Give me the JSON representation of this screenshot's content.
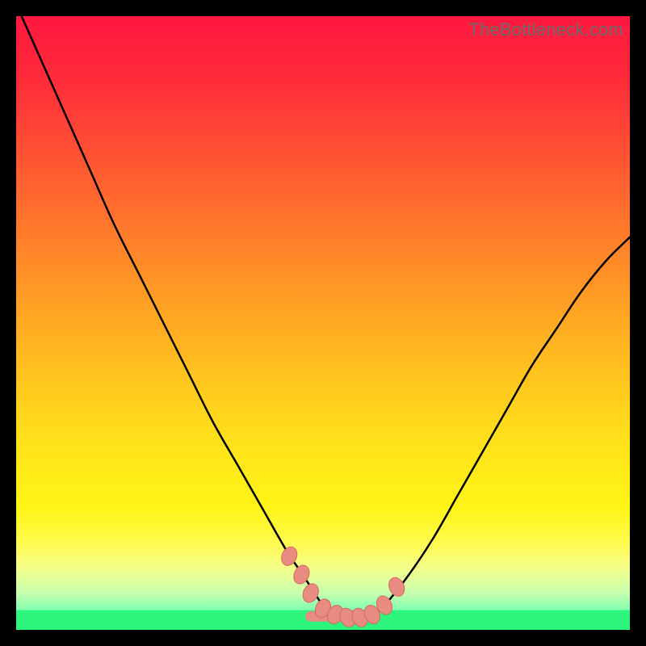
{
  "watermark": {
    "text": "TheBottleneck.com"
  },
  "colors": {
    "black": "#000000",
    "curve": "#000000",
    "marker_fill": "#e88b81",
    "marker_stroke": "#d66a60",
    "green_band": "#2bf57a",
    "gradient_stops": [
      {
        "offset": 0.0,
        "color": "#ff173f"
      },
      {
        "offset": 0.1,
        "color": "#ff2b3a"
      },
      {
        "offset": 0.2,
        "color": "#ff4a34"
      },
      {
        "offset": 0.3,
        "color": "#ff6a2e"
      },
      {
        "offset": 0.4,
        "color": "#ff8a28"
      },
      {
        "offset": 0.5,
        "color": "#ffaa22"
      },
      {
        "offset": 0.6,
        "color": "#ffc81e"
      },
      {
        "offset": 0.7,
        "color": "#ffe31a"
      },
      {
        "offset": 0.8,
        "color": "#fff516"
      },
      {
        "offset": 0.86,
        "color": "#fffb50"
      },
      {
        "offset": 0.9,
        "color": "#f4ff8c"
      },
      {
        "offset": 0.94,
        "color": "#c8ffb0"
      },
      {
        "offset": 0.97,
        "color": "#7affb0"
      },
      {
        "offset": 1.0,
        "color": "#1df57a"
      }
    ]
  },
  "chart_data": {
    "type": "line",
    "title": "",
    "xlabel": "",
    "ylabel": "",
    "xlim": [
      0,
      100
    ],
    "ylim": [
      0,
      100
    ],
    "grid": false,
    "legend": false,
    "series": [
      {
        "name": "bottleneck-curve",
        "x": [
          0,
          4,
          8,
          12,
          16,
          20,
          24,
          28,
          32,
          36,
          40,
          44,
          46,
          48,
          50,
          52,
          54,
          56,
          58,
          60,
          64,
          68,
          72,
          76,
          80,
          84,
          88,
          92,
          96,
          100
        ],
        "y": [
          102,
          93,
          84,
          75,
          66,
          58,
          50,
          42,
          34,
          27,
          20,
          13,
          10,
          7,
          4,
          2.5,
          2,
          2,
          2.5,
          4,
          9,
          15,
          22,
          29,
          36,
          43,
          49,
          55,
          60,
          64
        ]
      }
    ],
    "markers": {
      "name": "highlighted-points",
      "x": [
        44.5,
        46.5,
        48,
        50,
        52,
        54,
        56,
        58,
        60,
        62
      ],
      "y": [
        12,
        9,
        6,
        3.5,
        2.5,
        2,
        2,
        2.5,
        4,
        7
      ]
    },
    "flat_segment": {
      "x0": 48,
      "x1": 58,
      "y": 2.2
    }
  }
}
